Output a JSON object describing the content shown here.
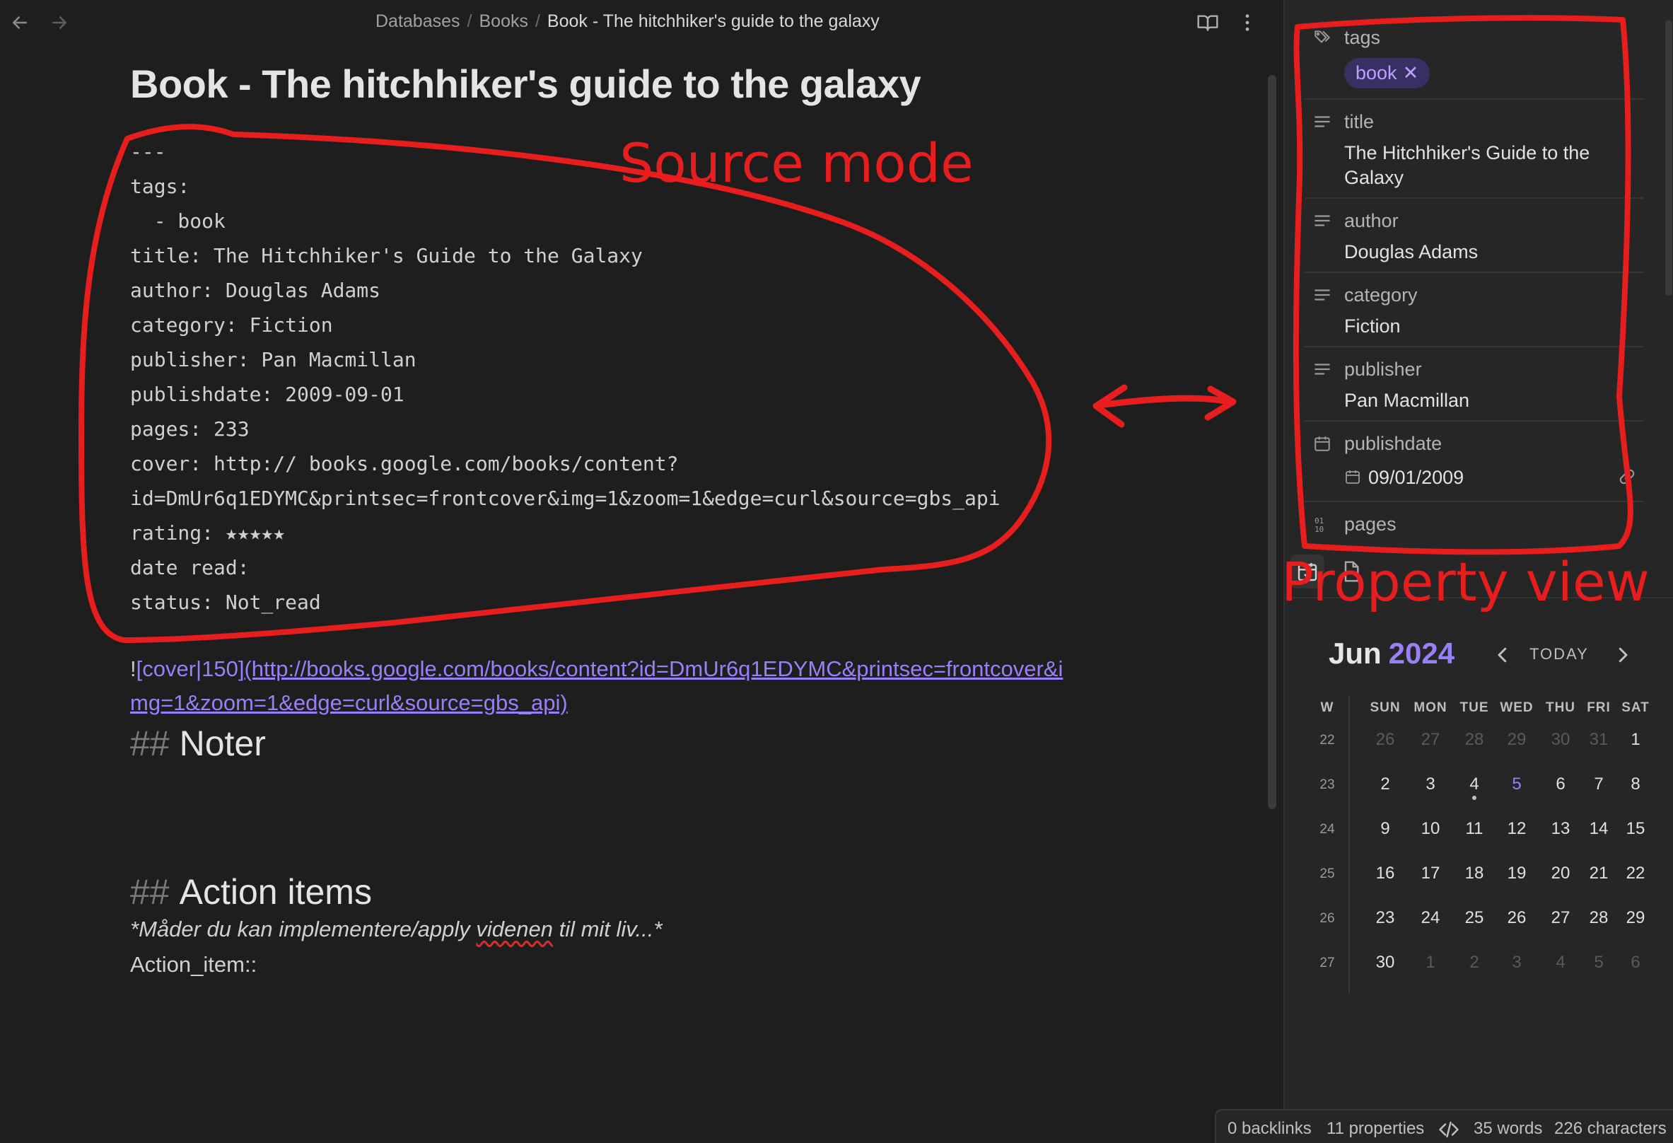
{
  "breadcrumb": [
    "Databases",
    "Books",
    "Book - The hitchhiker's guide to the galaxy"
  ],
  "breadcrumb_separator": "/",
  "page_title": "Book - The hitchhiker's guide to the galaxy",
  "frontmatter_lines": [
    "---",
    "tags:",
    "  - book",
    "title: The Hitchhiker's Guide to the Galaxy",
    "author: Douglas Adams",
    "category: Fiction",
    "publisher: Pan Macmillan",
    "publishdate: 2009-09-01",
    "pages: 233",
    "cover: http:// books.google.com/books/content?",
    "id=DmUr6q1EDYMC&printsec=frontcover&img=1&zoom=1&edge=curl&source=gbs_api",
    "rating: ★★★★★",
    "date read:",
    "status: Not_read",
    "---"
  ],
  "embed": {
    "bang": "!",
    "link_text": "[cover|150]",
    "url_line1": "(http://books.google.com/books/content?id=DmUr6q1EDYMC&printsec=frontcover&i",
    "url_line2": "mg=1&zoom=1&edge=curl&source=gbs_api)"
  },
  "headings": {
    "hash": "##",
    "noter": "Noter",
    "action_items": "Action items"
  },
  "italic_line": {
    "before": "*Måder du kan implementere/apply ",
    "misspelled": "videnen",
    "after": " til mit liv...*"
  },
  "action_item_line": "Action_item::",
  "properties": {
    "tags": {
      "label": "tags",
      "icon": "tags-icon",
      "values": [
        "book"
      ],
      "remove_glyph": "✕"
    },
    "title": {
      "label": "title",
      "icon": "text-lines-icon",
      "value_lines": [
        "The Hitchhiker's Guide to the",
        "Galaxy"
      ]
    },
    "author": {
      "label": "author",
      "icon": "text-lines-icon",
      "value": "Douglas Adams"
    },
    "category": {
      "label": "category",
      "icon": "text-lines-icon",
      "value": "Fiction"
    },
    "publisher": {
      "label": "publisher",
      "icon": "text-lines-icon",
      "value": "Pan Macmillan"
    },
    "publishdate": {
      "label": "publishdate",
      "icon": "calendar-icon",
      "value": "09/01/2009"
    },
    "pages": {
      "label": "pages",
      "icon": "number-icon"
    }
  },
  "calendar": {
    "month": "Jun",
    "year": "2024",
    "today_label": "TODAY",
    "weekday_headers": [
      "W",
      "SUN",
      "MON",
      "TUE",
      "WED",
      "THU",
      "FRI",
      "SAT"
    ],
    "weeks": [
      {
        "week": "22",
        "days": [
          "26",
          "27",
          "28",
          "29",
          "30",
          "31",
          "1"
        ],
        "muted": [
          true,
          true,
          true,
          true,
          true,
          true,
          false
        ]
      },
      {
        "week": "23",
        "days": [
          "2",
          "3",
          "4",
          "5",
          "6",
          "7",
          "8"
        ],
        "muted": [
          false,
          false,
          false,
          false,
          false,
          false,
          false
        ]
      },
      {
        "week": "24",
        "days": [
          "9",
          "10",
          "11",
          "12",
          "13",
          "14",
          "15"
        ],
        "muted": [
          false,
          false,
          false,
          false,
          false,
          false,
          false
        ]
      },
      {
        "week": "25",
        "days": [
          "16",
          "17",
          "18",
          "19",
          "20",
          "21",
          "22"
        ],
        "muted": [
          false,
          false,
          false,
          false,
          false,
          false,
          false
        ]
      },
      {
        "week": "26",
        "days": [
          "23",
          "24",
          "25",
          "26",
          "27",
          "28",
          "29"
        ],
        "muted": [
          false,
          false,
          false,
          false,
          false,
          false,
          false
        ]
      },
      {
        "week": "27",
        "days": [
          "30",
          "1",
          "2",
          "3",
          "4",
          "5",
          "6"
        ],
        "muted": [
          false,
          true,
          true,
          true,
          true,
          true,
          true
        ]
      }
    ],
    "today_day": "5",
    "dot_day": "4"
  },
  "status_bar": {
    "backlinks": "0 backlinks",
    "properties": "11 properties",
    "words": "35 words",
    "characters": "226 characters"
  },
  "annotations": {
    "source_mode": "Source mode",
    "property_view": "Property view"
  },
  "colors": {
    "background": "#1e1e1e",
    "sidebar_background": "#262626",
    "accent": "#9a7ffa",
    "annotation_red": "#e81d1d",
    "tag_pill_background": "#3a2f63"
  }
}
